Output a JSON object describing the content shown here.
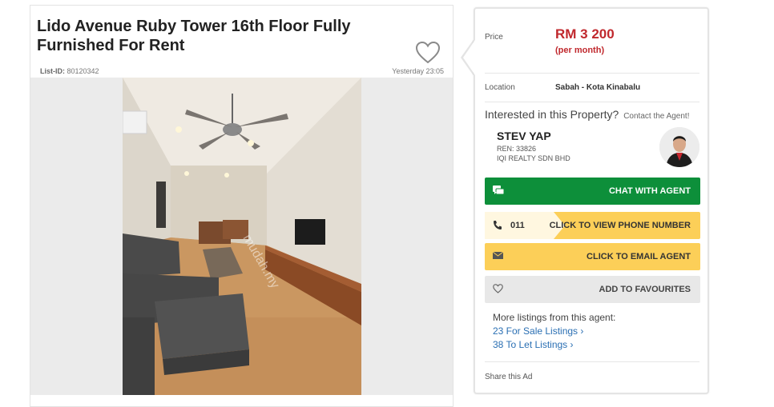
{
  "listing": {
    "title": "Lido Avenue Ruby Tower 16th Floor Fully Furnished For Rent",
    "list_id_label": "List-ID:",
    "list_id_value": "80120342",
    "posted": "Yesterday 23:05"
  },
  "panel": {
    "price_label": "Price",
    "price_value": "RM 3 200",
    "price_period": "(per month)",
    "location_label": "Location",
    "location_value": "Sabah - Kota Kinabalu",
    "interested_text": "Interested in this Property?",
    "contact_agent_text": "Contact the Agent!"
  },
  "agent": {
    "name": "STEV YAP",
    "ren": "REN: 33826",
    "company": "IQI REALTY SDN BHD"
  },
  "buttons": {
    "chat": "CHAT WITH AGENT",
    "phone_prefix": "011",
    "phone": "CLICK TO VIEW PHONE NUMBER",
    "email": "CLICK TO EMAIL AGENT",
    "favourites": "ADD TO FAVOURITES"
  },
  "more_listings": {
    "heading": "More listings from this agent:",
    "sale": "23 For Sale Listings ›",
    "let": "38 To Let Listings ›"
  },
  "share_label": "Share this Ad",
  "photo_watermark": "mudah.my",
  "colors": {
    "price": "#c0282d",
    "chat_button": "#0d8f3a",
    "phone_email_button": "#fccf58",
    "link": "#2a6fb3"
  },
  "icons": {
    "favourite": "heart-icon",
    "chat": "chat-bubble-icon",
    "phone": "phone-icon",
    "email": "envelope-icon"
  }
}
